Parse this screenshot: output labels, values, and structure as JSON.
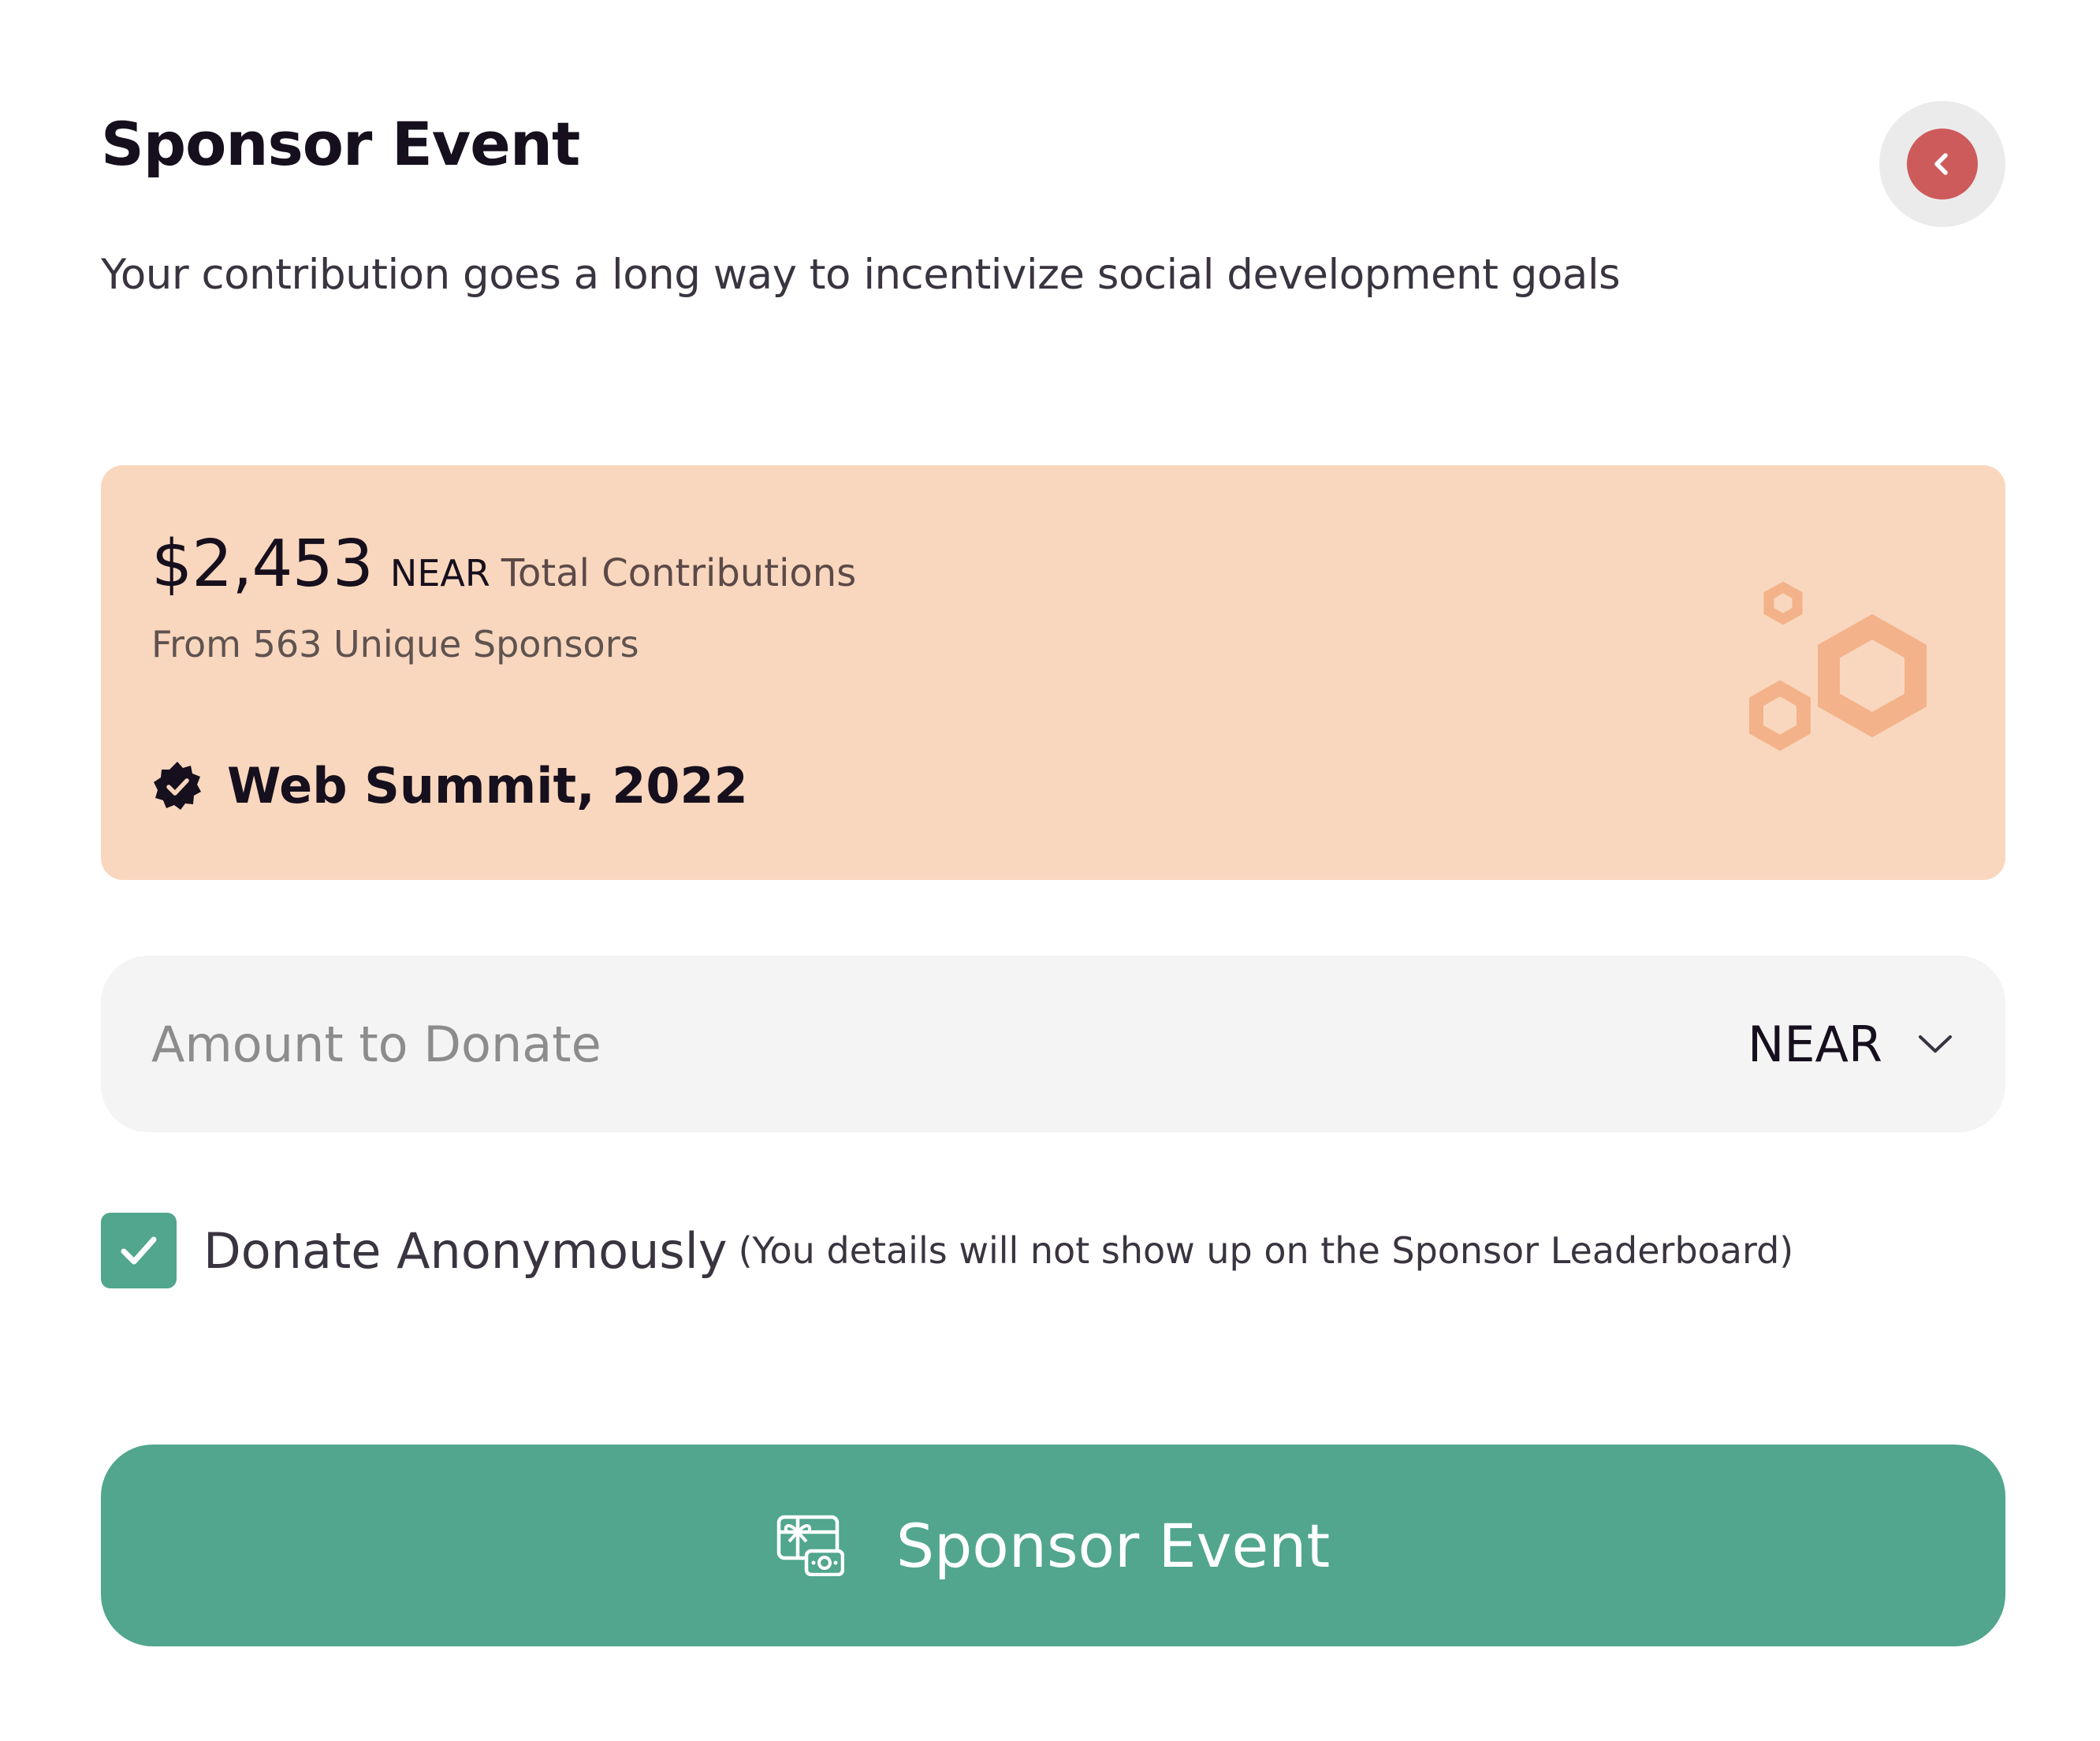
{
  "header": {
    "title": "Sponsor Event",
    "subtitle": "Your contribution goes a long way to incentivize social development goals",
    "back_icon": "chevron-left-icon",
    "back_color": "#cd5b5b"
  },
  "stats": {
    "amount": "$2,453",
    "currency": "NEAR",
    "total_label": "Total Contributions",
    "sponsors_text": "From 563 Unique Sponsors",
    "event_name": "Web Summit, 2022",
    "event_icon": "verified-badge-icon",
    "decoration_icon": "hexagons-icon",
    "card_color": "#f9d7be",
    "accent_color": "#f3b289"
  },
  "donation": {
    "amount_placeholder": "Amount to Donate",
    "amount_value": "",
    "currency_selected": "NEAR",
    "currency_icon": "chevron-down-icon"
  },
  "anonymous": {
    "checked": true,
    "label": "Donate Anonymously",
    "note": "(You details will not show up on the Sponsor Leaderboard)",
    "check_color": "#51a68d"
  },
  "submit": {
    "label": "Sponsor Event",
    "icon": "gift-money-icon",
    "color": "#51a68d"
  }
}
